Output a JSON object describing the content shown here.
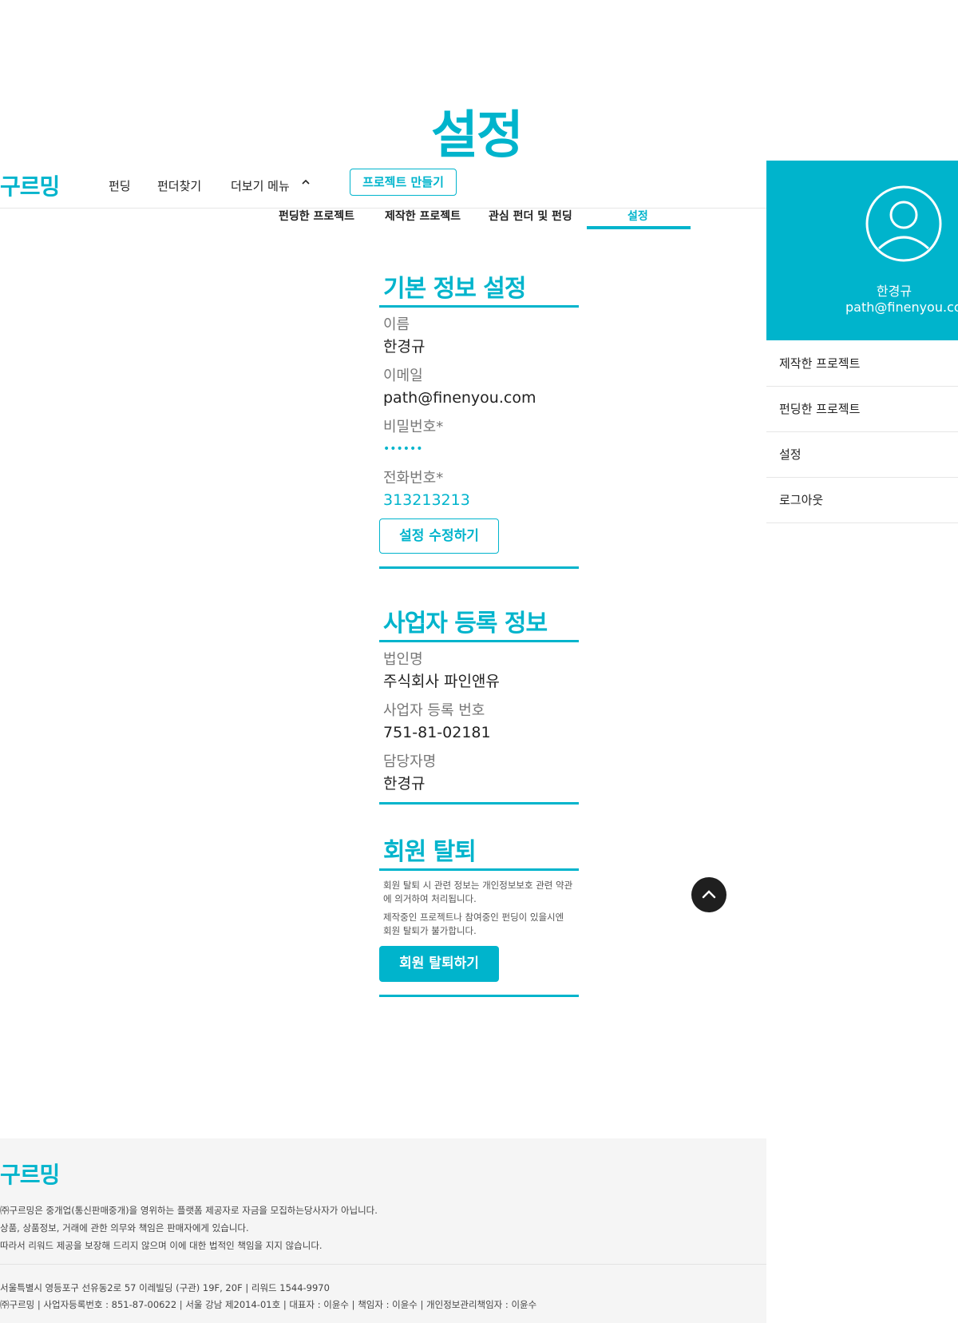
{
  "page_title": "설정",
  "header": {
    "logo": "구르밍",
    "nav": [
      "펀딩",
      "펀더찾기",
      "더보기 메뉴"
    ],
    "create_button": "프로젝트 만들기"
  },
  "tabs": [
    {
      "label": "펀딩한 프로젝트",
      "active": false
    },
    {
      "label": "제작한 프로젝트",
      "active": false
    },
    {
      "label": "관심 펀더 및 펀딩",
      "active": false
    },
    {
      "label": "설정",
      "active": true
    }
  ],
  "basic_info": {
    "title": "기본 정보 설정",
    "name_label": "이름",
    "name_value": "한경규",
    "email_label": "이메일",
    "email_value": "path@finenyou.com",
    "password_label": "비밀번호*",
    "password_value": "••••••",
    "phone_label": "전화번호*",
    "phone_value": "313213213",
    "edit_button": "설정 수정하기"
  },
  "business_info": {
    "title": "사업자 등록 정보",
    "corp_label": "법인명",
    "corp_value": "주식회사 파인앤유",
    "regno_label": "사업자 등록 번호",
    "regno_value": "751-81-02181",
    "manager_label": "담당자명",
    "manager_value": "한경규"
  },
  "withdraw": {
    "title": "회원 탈퇴",
    "line1a": "회원 탈퇴 시 관련 정보는 개인정보보호 관련 약관",
    "line1b": "에 의거하여 처리됩니다.",
    "line2a": "제작중인 프로젝트나 참여중인 펀딩이 있을시엔",
    "line2b": "회원 탈퇴가 불가합니다.",
    "button": "회원 탈퇴하기"
  },
  "profile": {
    "name": "한경규",
    "email": "path@finenyou.com",
    "menu": [
      "제작한 프로젝트",
      "펀딩한 프로젝트",
      "설정",
      "로그아웃"
    ]
  },
  "footer": {
    "logo": "구르밍",
    "line1": "㈜구르밍은 중개업(통신판매중개)을 영위하는 플랫폼 제공자로 자금을 모집하는당사자가 아닙니다.",
    "line2": "상품, 상품정보, 거래에 관한 의무와 책임은 판매자에게 있습니다.",
    "line3": "따라서 리워드 제공을 보장해 드리지 않으며 이에 대한 법적인 책임을 지지 않습니다.",
    "line4": "서울특별시 영등포구 선유동2로 57 이레빌딩 (구관) 19F, 20F | 리워드 1544-9970",
    "line5": "㈜구르밍  |  사업자등록번호 : 851-87-00622  |  서울 강남 제2014-01호  |  대표자 : 이윤수  |  책임자 : 이윤수  |  개인정보관리책임자 : 이윤수"
  },
  "colors": {
    "accent": "#00b4cc",
    "scroll_button": "#1f1f1f",
    "footer_bg": "#f5f5f5"
  },
  "icons": [
    "chevron-up-icon",
    "user-avatar-icon",
    "arrow-up-icon"
  ]
}
